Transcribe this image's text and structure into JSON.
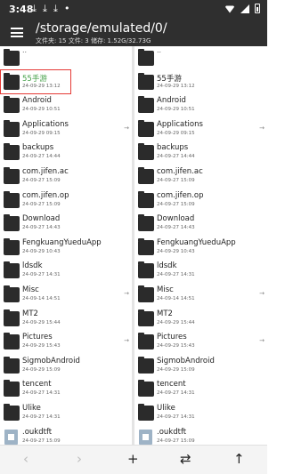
{
  "status_bar": {
    "time": "3:48",
    "icons": [
      "download-icon",
      "download-icon",
      "download-icon",
      "notification-icon",
      "wifi-icon",
      "signal-icon",
      "battery-icon"
    ]
  },
  "toolbar": {
    "path": "/storage/emulated/0/",
    "info": "文件夹: 15  文件: 3  储存: 1.52G/32.73G"
  },
  "left_pane": {
    "up_label": "..",
    "items": [
      {
        "name": "55手游",
        "date": "24-09-29 13:12",
        "type": "folder",
        "selected": true
      },
      {
        "name": "Android",
        "date": "24-09-29 10:51",
        "type": "folder"
      },
      {
        "name": "Applications",
        "date": "24-09-29 09:15",
        "type": "folder",
        "link": "→"
      },
      {
        "name": "backups",
        "date": "24-09-27 14:44",
        "type": "folder"
      },
      {
        "name": "com.jifen.ac",
        "date": "24-09-27 15:09",
        "type": "folder"
      },
      {
        "name": "com.jifen.op",
        "date": "24-09-27 15:09",
        "type": "folder"
      },
      {
        "name": "Download",
        "date": "24-09-27 14:43",
        "type": "folder"
      },
      {
        "name": "FengkuangYueduApp",
        "date": "24-09-29 10:43",
        "type": "folder"
      },
      {
        "name": "ldsdk",
        "date": "24-09-27 14:31",
        "type": "folder"
      },
      {
        "name": "Misc",
        "date": "24-09-14 14:51",
        "type": "folder",
        "link": "→"
      },
      {
        "name": "MT2",
        "date": "24-09-29 15:44",
        "type": "folder"
      },
      {
        "name": "Pictures",
        "date": "24-09-29 15:43",
        "type": "folder",
        "link": "→"
      },
      {
        "name": "SigmobAndroid",
        "date": "24-09-29 15:09",
        "type": "folder"
      },
      {
        "name": "tencent",
        "date": "24-09-27 14:31",
        "type": "folder"
      },
      {
        "name": "Ulike",
        "date": "24-09-27 14:31",
        "type": "folder"
      },
      {
        "name": ".oukdtft",
        "date": "24-09-27 15:09",
        "type": "file"
      }
    ]
  },
  "right_pane": {
    "up_label": "..",
    "items": [
      {
        "name": "55手游",
        "date": "24-09-29 13:12",
        "type": "folder"
      },
      {
        "name": "Android",
        "date": "24-09-29 10:51",
        "type": "folder"
      },
      {
        "name": "Applications",
        "date": "24-09-29 09:15",
        "type": "folder",
        "link": "→"
      },
      {
        "name": "backups",
        "date": "24-09-27 14:44",
        "type": "folder"
      },
      {
        "name": "com.jifen.ac",
        "date": "24-09-27 15:09",
        "type": "folder"
      },
      {
        "name": "com.jifen.op",
        "date": "24-09-27 15:09",
        "type": "folder"
      },
      {
        "name": "Download",
        "date": "24-09-27 14:43",
        "type": "folder"
      },
      {
        "name": "FengkuangYueduApp",
        "date": "24-09-29 10:43",
        "type": "folder"
      },
      {
        "name": "ldsdk",
        "date": "24-09-27 14:31",
        "type": "folder"
      },
      {
        "name": "Misc",
        "date": "24-09-14 14:51",
        "type": "folder",
        "link": "→"
      },
      {
        "name": "MT2",
        "date": "24-09-29 15:44",
        "type": "folder"
      },
      {
        "name": "Pictures",
        "date": "24-09-29 15:43",
        "type": "folder",
        "link": "→"
      },
      {
        "name": "SigmobAndroid",
        "date": "24-09-29 15:09",
        "type": "folder"
      },
      {
        "name": "tencent",
        "date": "24-09-27 14:31",
        "type": "folder"
      },
      {
        "name": "Ulike",
        "date": "24-09-27 14:31",
        "type": "folder"
      },
      {
        "name": ".oukdtft",
        "date": "24-09-27 15:09",
        "type": "file"
      }
    ]
  },
  "bottom_bar": {
    "back": "‹",
    "forward": "›",
    "add": "+",
    "swap": "⇄",
    "up": "↑"
  },
  "colors": {
    "toolbar_bg": "#2f2f2f",
    "selected_text": "#43a047",
    "highlight_border": "#e53935"
  }
}
